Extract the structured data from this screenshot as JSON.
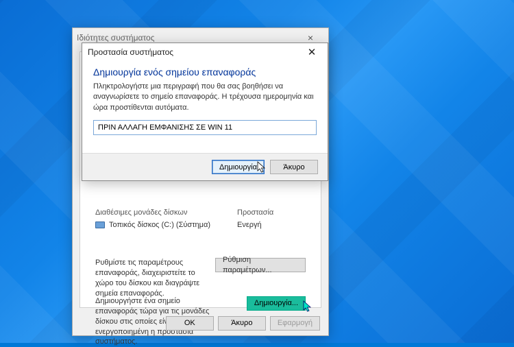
{
  "wallpaper": {
    "accent": "#0078d7"
  },
  "props_window": {
    "title": "Ιδιότητες συστήματος",
    "drives": {
      "col_available": "Διαθέσιμες μονάδες δίσκων",
      "col_protection": "Προστασία",
      "row_drive": "Τοπικός δίσκος (C:) (Σύστημα)",
      "row_status": "Ενεργή"
    },
    "configure_text": "Ρυθμίστε τις παραμέτρους επαναφοράς, διαχειριστείτε το χώρο του δίσκου και διαγράψτε σημεία επαναφοράς.",
    "configure_button": "Ρύθμιση παραμέτρων...",
    "create_text": "Δημιουργήστε ένα σημείο επαναφοράς τώρα για τις μονάδες δίσκου στις οποίες είναι ενεργοποιημένη η προστασία συστήματος.",
    "create_button": "Δημιουργία...",
    "footer": {
      "ok": "OK",
      "cancel": "Άκυρο",
      "apply": "Εφαρμογή"
    }
  },
  "dialog": {
    "title": "Προστασία συστήματος",
    "heading": "Δημιουργία ενός σημείου επαναφοράς",
    "description": "Πληκτρολογήστε μια περιγραφή που θα σας βοηθήσει να αναγνωρίσετε το σημείο επαναφοράς. Η τρέχουσα ημερομηνία και ώρα προστίθενται αυτόματα.",
    "input_value": "ΠΡΙΝ ΑΛΛΑΓΗ ΕΜΦΑΝΙΣΗΣ ΣΕ WIN 11",
    "create": "Δημιουργία",
    "cancel": "Άκυρο"
  }
}
